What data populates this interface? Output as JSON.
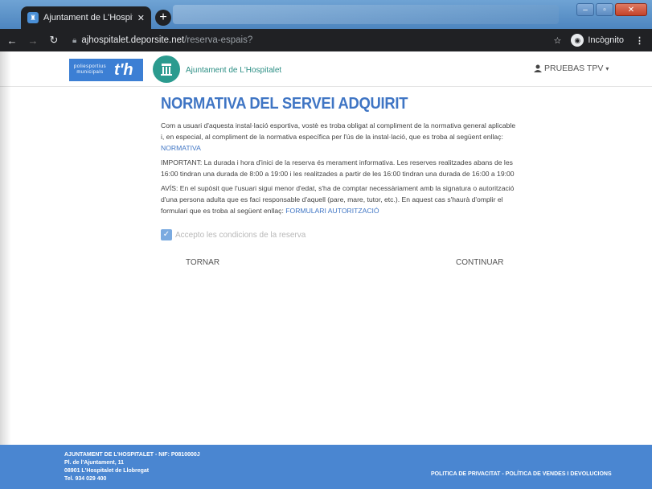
{
  "browser": {
    "tab_title": "Ajuntament de L'Hospitalet | Res",
    "new_tab_symbol": "+",
    "url_domain": "ajhospitalet.deporsite.net",
    "url_path": "/reserva-espais?",
    "incognito_label": "Incògnito"
  },
  "header": {
    "poli_logo_text": "poliesportius municipals",
    "poli_logo_mark": "t'h",
    "site_name": "Ajuntament de L'Hospitalet",
    "user_name": "PRUEBAS TPV"
  },
  "main": {
    "title": "NORMATIVA DEL SERVEI ADQUIRIT",
    "para1_text": "Com a usuari d'aquesta instal·lació esportiva, vostè es troba obligat al compliment de la normativa general aplicable i, en especial, al compliment de la normativa específica per l'ús de la instal·lació, que es troba al següent enllaç: ",
    "para1_link": "NORMATIVA",
    "para2_text": "IMPORTANT: La durada i hora d'inici de la reserva és merament informativa. Les reserves realitzades abans de les 16:00 tindran una durada de 8:00 a 19:00 i les realitzades a partir de les 16:00 tindran una durada de 16:00 a 19:00",
    "para3_text": "AVÍS: En el supòsit que l'usuari sigui menor d'edat, s'ha de comptar necessàriament amb la signatura o autorització d'una persona adulta que es faci responsable d'aquell (pare, mare, tutor, etc.). En aquest cas s'haurà d'omplir el formulari que es troba al següent enllaç: ",
    "para3_link": "FORMULARI AUTORITZACIÓ",
    "accept_label": "Accepto les condicions de la reserva",
    "accept_checked": true,
    "back_label": "TORNAR",
    "continue_label": "CONTINUAR"
  },
  "footer": {
    "line1": "AJUNTAMENT DE L'HOSPITALET - NIF: P0810000J",
    "line2": "Pl. de l'Ajuntament, 11",
    "line3": "08901 L'Hospitalet de Llobregat",
    "line4": "Tel. 934 029 400",
    "legal_links": "POLITICA DE PRIVACITAT - POLÍTICA DE VENDES I DEVOLUCIONS"
  },
  "colors": {
    "accent": "#3f75c4",
    "footer_bg": "#4a86d1",
    "brand_teal": "#2b9b8f"
  }
}
